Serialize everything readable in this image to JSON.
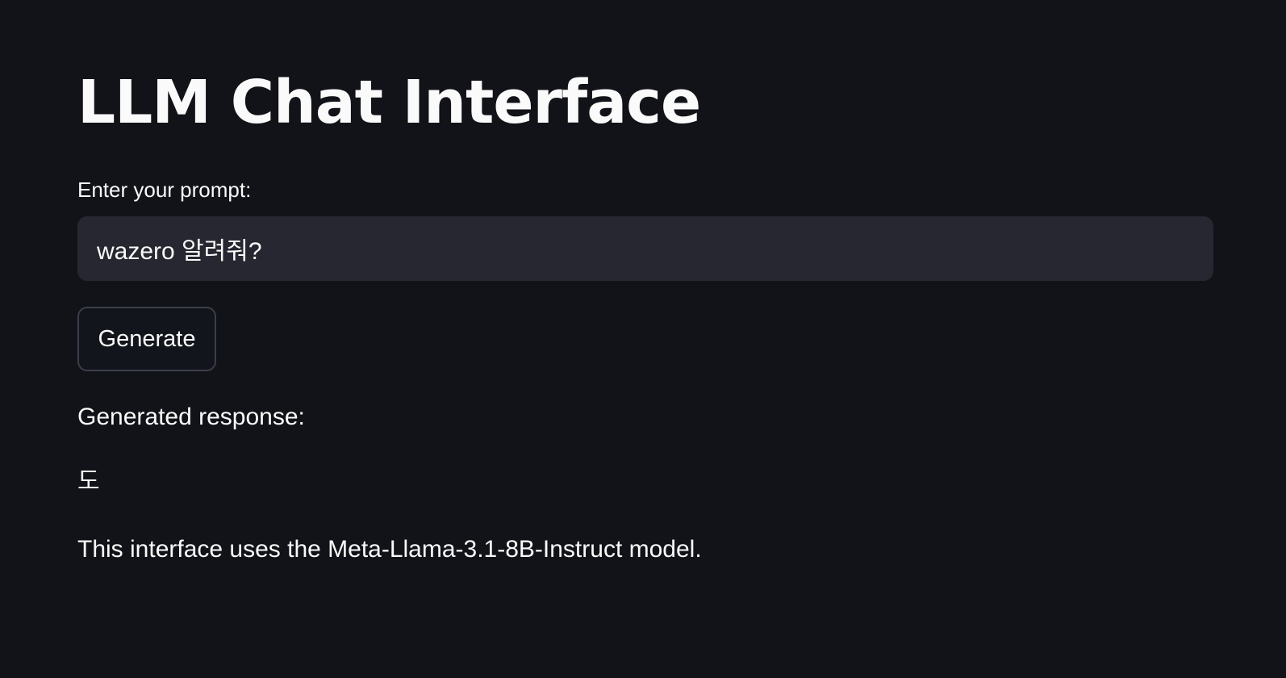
{
  "app": {
    "title": "LLM Chat Interface"
  },
  "prompt": {
    "label": "Enter your prompt:",
    "value": "wazero 알려줘?"
  },
  "actions": {
    "generate_label": "Generate"
  },
  "response": {
    "label": "Generated response:",
    "text": "도"
  },
  "footer": {
    "note": "This interface uses the Meta-Llama-3.1-8B-Instruct model."
  },
  "colors": {
    "background": "#111318",
    "input_background": "#262730",
    "text": "#fafafa",
    "button_border": "#3b3e4a"
  }
}
